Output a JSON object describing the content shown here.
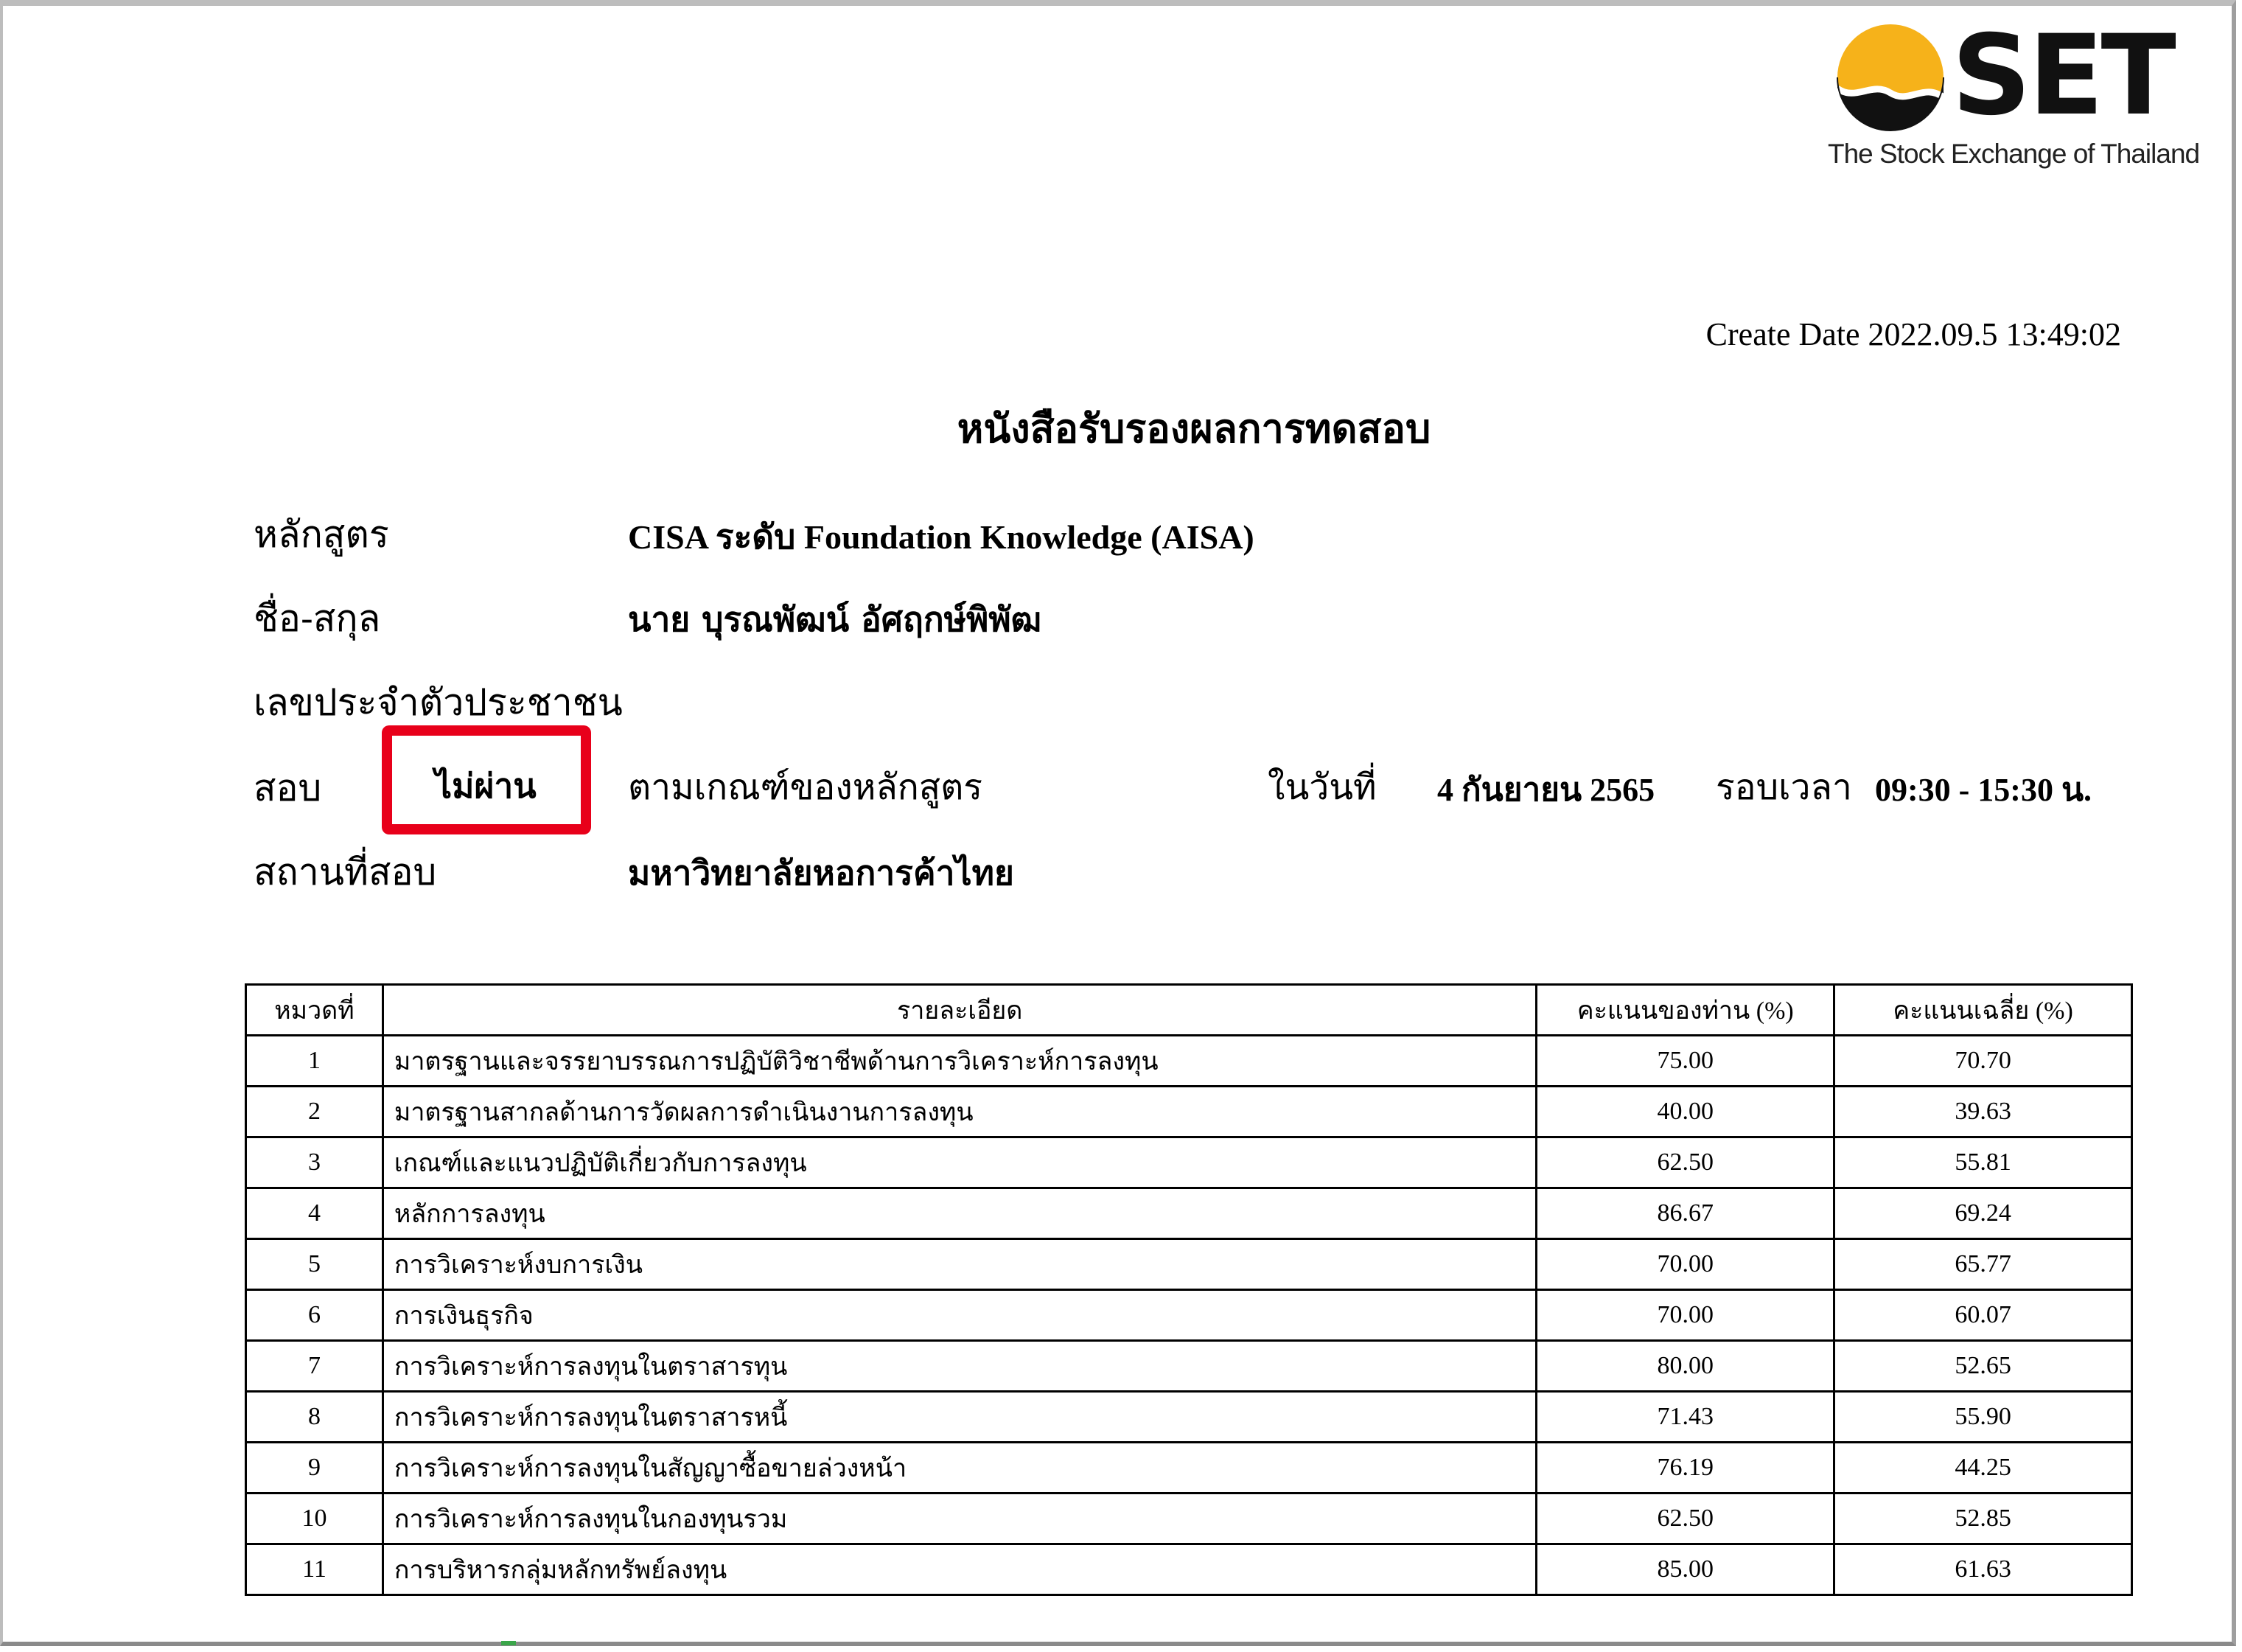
{
  "logo": {
    "name": "SET",
    "subtitle": "The Stock Exchange of Thailand",
    "colors": {
      "gold": "#f6b21a",
      "black": "#111111"
    }
  },
  "create_date": "Create Date 2022.09.5 13:49:02",
  "title": "หนังสือรับรองผลการทดสอบ",
  "fields": {
    "course_label": "หลักสูตร",
    "course_value": "CISA ระดับ Foundation Knowledge (AISA)",
    "name_label": "ชื่อ-สกุล",
    "name_value": "นาย บุรณพัฒน์ อัศฤกษ์พิพัฒ",
    "id_label": "เลขประจำตัวประชาชน",
    "exam_label": "สอบ",
    "result": "ไม่ผ่าน",
    "criteria_text": "ตามเกณฑ์ของหลักสูตร",
    "date_label": "ในวันที่",
    "date_value": "4 กันยายน 2565",
    "time_label": "รอบเวลา",
    "time_value": "09:30 - 15:30 น.",
    "venue_label": "สถานที่สอบ",
    "venue_value": "มหาวิทยาลัยหอการค้าไทย"
  },
  "table": {
    "headers": [
      "หมวดที่",
      "รายละเอียด",
      "คะแนนของท่าน (%)",
      "คะแนนเฉลี่ย (%)"
    ],
    "rows": [
      [
        "1",
        "มาตรฐานและจรรยาบรรณการปฏิบัติวิชาชีพด้านการวิเคราะห์การลงทุน",
        "75.00",
        "70.70"
      ],
      [
        "2",
        "มาตรฐานสากลด้านการวัดผลการดำเนินงานการลงทุน",
        "40.00",
        "39.63"
      ],
      [
        "3",
        "เกณฑ์และแนวปฏิบัติเกี่ยวกับการลงทุน",
        "62.50",
        "55.81"
      ],
      [
        "4",
        "หลักการลงทุน",
        "86.67",
        "69.24"
      ],
      [
        "5",
        "การวิเคราะห์งบการเงิน",
        "70.00",
        "65.77"
      ],
      [
        "6",
        "การเงินธุรกิจ",
        "70.00",
        "60.07"
      ],
      [
        "7",
        "การวิเคราะห์การลงทุนในตราสารทุน",
        "80.00",
        "52.65"
      ],
      [
        "8",
        "การวิเคราะห์การลงทุนในตราสารหนี้",
        "71.43",
        "55.90"
      ],
      [
        "9",
        "การวิเคราะห์การลงทุนในสัญญาซื้อขายล่วงหน้า",
        "76.19",
        "44.25"
      ],
      [
        "10",
        "การวิเคราะห์การลงทุนในกองทุนรวม",
        "62.50",
        "52.85"
      ],
      [
        "11",
        "การบริหารกลุ่มหลักทรัพย์ลงทุน",
        "85.00",
        "61.63"
      ]
    ]
  },
  "highlight_color": "#e8001a"
}
